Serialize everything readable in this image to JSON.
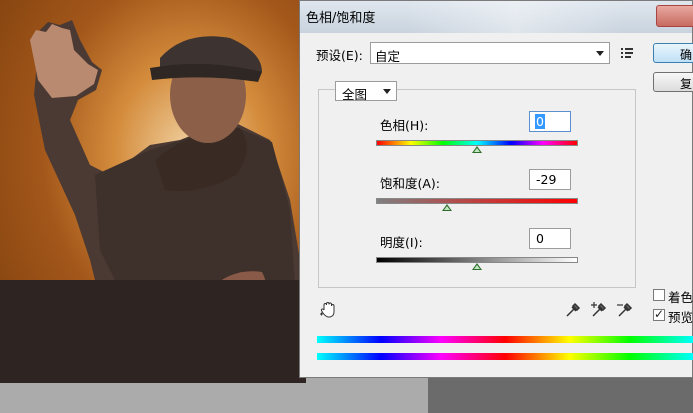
{
  "dialog": {
    "title": "色相/饱和度",
    "preset_label": "预设(E):",
    "preset_value": "自定",
    "ok_label": "确",
    "reset_label": "复",
    "edit_value": "全图",
    "hue": {
      "label": "色相(H):",
      "value": "0"
    },
    "saturation": {
      "label": "饱和度(A):",
      "value": "-29"
    },
    "lightness": {
      "label": "明度(I):",
      "value": "0"
    },
    "colorize_label": "着色",
    "preview_label": "预览",
    "colorize_checked": false,
    "preview_checked": true
  },
  "colors": {
    "dialog_bg": "#f0f0f0",
    "photo_bg": "#a3571a",
    "thumb": "#2d6d2d"
  },
  "icons": [
    "preset-menu-icon",
    "hand-adjust-icon",
    "eyedropper-icon",
    "eyedropper-plus-icon",
    "eyedropper-minus-icon"
  ]
}
